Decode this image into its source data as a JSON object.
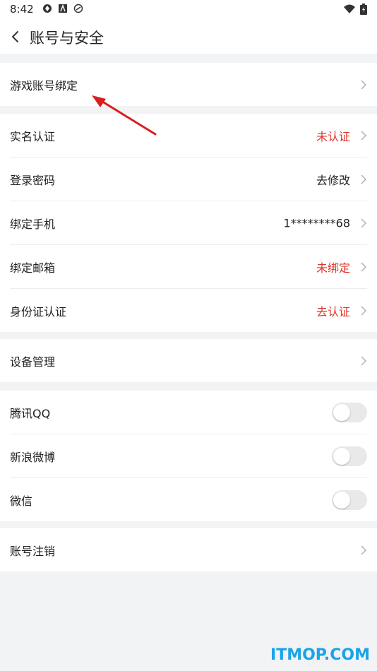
{
  "status_bar": {
    "time": "8:42",
    "left_icons": [
      "status-icon-1",
      "status-icon-2",
      "status-icon-3"
    ],
    "right_icons": [
      "wifi-icon",
      "battery-icon"
    ]
  },
  "header": {
    "title": "账号与安全",
    "back_icon": "chevron-left-icon"
  },
  "sections": [
    {
      "items": [
        {
          "label": "游戏账号绑定",
          "value": "",
          "type": "link"
        }
      ]
    },
    {
      "items": [
        {
          "label": "实名认证",
          "value": "未认证",
          "value_color": "#e0362c",
          "type": "link"
        },
        {
          "label": "登录密码",
          "value": "去修改",
          "value_color": "#222222",
          "type": "link"
        },
        {
          "label": "绑定手机",
          "value": "1********68",
          "value_color": "#222222",
          "type": "link"
        },
        {
          "label": "绑定邮箱",
          "value": "未绑定",
          "value_color": "#e0362c",
          "type": "link"
        },
        {
          "label": "身份证认证",
          "value": "去认证",
          "value_color": "#e0362c",
          "type": "link"
        }
      ]
    },
    {
      "items": [
        {
          "label": "设备管理",
          "value": "",
          "type": "link"
        }
      ]
    },
    {
      "items": [
        {
          "label": "腾讯QQ",
          "type": "toggle",
          "on": false
        },
        {
          "label": "新浪微博",
          "type": "toggle",
          "on": false
        },
        {
          "label": "微信",
          "type": "toggle",
          "on": false
        }
      ]
    },
    {
      "items": [
        {
          "label": "账号注销",
          "value": "",
          "type": "link"
        }
      ]
    }
  ],
  "watermark": "ITMOP.COM",
  "colors": {
    "accent_red": "#e0362c",
    "background": "#f2f3f5",
    "watermark": "#1aa3e8",
    "annotation_arrow": "#d81e1e"
  }
}
